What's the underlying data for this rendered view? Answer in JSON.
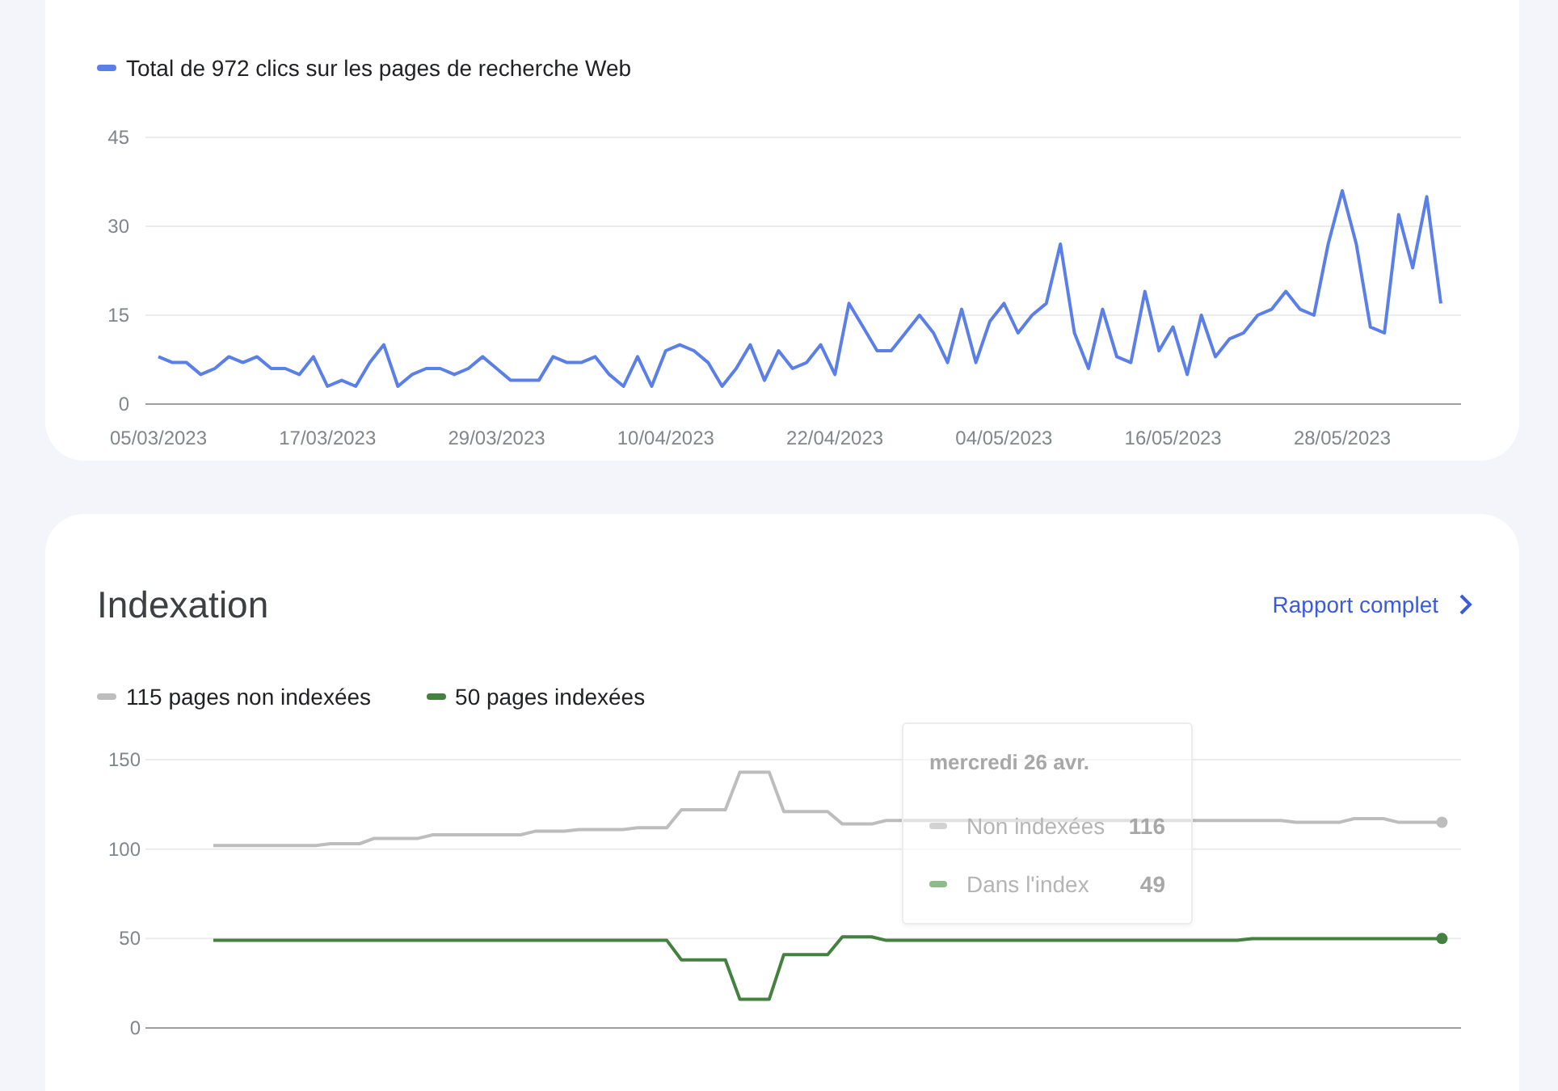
{
  "performance": {
    "chart_data": {
      "type": "line",
      "ylim": [
        0,
        45
      ],
      "yticks": [
        0,
        15,
        30,
        45
      ],
      "categories": [
        "05/03/2023",
        null,
        null,
        null,
        null,
        null,
        null,
        null,
        null,
        null,
        null,
        null,
        "17/03/2023",
        null,
        null,
        null,
        null,
        null,
        null,
        null,
        null,
        null,
        null,
        null,
        "29/03/2023",
        null,
        null,
        null,
        null,
        null,
        null,
        null,
        null,
        null,
        null,
        null,
        "10/04/2023",
        null,
        null,
        null,
        null,
        null,
        null,
        null,
        null,
        null,
        null,
        null,
        "22/04/2023",
        null,
        null,
        null,
        null,
        null,
        null,
        null,
        null,
        null,
        null,
        null,
        "04/05/2023",
        null,
        null,
        null,
        null,
        null,
        null,
        null,
        null,
        null,
        null,
        null,
        "16/05/2023",
        null,
        null,
        null,
        null,
        null,
        null,
        null,
        null,
        null,
        null,
        null,
        "28/05/2023",
        null,
        null,
        null,
        null,
        null,
        null,
        null
      ],
      "series": [
        {
          "name": "Total de 972 clics sur les pages de recherche Web",
          "color": "#5b7fe8",
          "values": [
            8,
            7,
            7,
            5,
            6,
            8,
            7,
            8,
            6,
            6,
            5,
            8,
            3,
            4,
            3,
            7,
            10,
            3,
            5,
            6,
            6,
            5,
            6,
            8,
            6,
            4,
            4,
            4,
            8,
            7,
            7,
            8,
            5,
            3,
            8,
            3,
            9,
            10,
            9,
            7,
            3,
            6,
            10,
            4,
            9,
            6,
            7,
            10,
            5,
            17,
            13,
            9,
            9,
            12,
            15,
            12,
            7,
            16,
            7,
            14,
            17,
            12,
            15,
            17,
            27,
            12,
            6,
            16,
            8,
            7,
            19,
            9,
            13,
            5,
            15,
            8,
            11,
            12,
            15,
            16,
            19,
            16,
            15,
            27,
            36,
            27,
            13,
            12,
            32,
            23,
            35,
            17
          ]
        }
      ]
    }
  },
  "indexation": {
    "title": "Indexation",
    "link": {
      "label": "Rapport complet"
    },
    "chart_data": {
      "type": "line",
      "ylim": [
        0,
        150
      ],
      "yticks": [
        0,
        50,
        100,
        150
      ],
      "series": [
        {
          "name": "115 pages non indexées",
          "color": "#bdbdbd",
          "values": [
            102,
            102,
            102,
            102,
            102,
            102,
            102,
            102,
            103,
            103,
            103,
            106,
            106,
            106,
            106,
            108,
            108,
            108,
            108,
            108,
            108,
            108,
            110,
            110,
            110,
            111,
            111,
            111,
            111,
            112,
            112,
            112,
            122,
            122,
            122,
            122,
            143,
            143,
            143,
            121,
            121,
            121,
            121,
            114,
            114,
            114,
            116,
            116,
            116,
            116,
            116,
            116,
            116,
            116,
            116,
            116,
            116,
            116,
            116,
            116,
            116,
            116,
            116,
            116,
            116,
            116,
            116,
            116,
            116,
            116,
            116,
            116,
            116,
            116,
            115,
            115,
            115,
            115,
            117,
            117,
            117,
            115,
            115,
            115,
            115
          ]
        },
        {
          "name": "50 pages indexées",
          "color": "#44803f",
          "values": [
            49,
            49,
            49,
            49,
            49,
            49,
            49,
            49,
            49,
            49,
            49,
            49,
            49,
            49,
            49,
            49,
            49,
            49,
            49,
            49,
            49,
            49,
            49,
            49,
            49,
            49,
            49,
            49,
            49,
            49,
            49,
            49,
            38,
            38,
            38,
            38,
            16,
            16,
            16,
            41,
            41,
            41,
            41,
            51,
            51,
            51,
            49,
            49,
            49,
            49,
            49,
            49,
            49,
            49,
            49,
            49,
            49,
            49,
            49,
            49,
            49,
            49,
            49,
            49,
            49,
            49,
            49,
            49,
            49,
            49,
            49,
            50,
            50,
            50,
            50,
            50,
            50,
            50,
            50,
            50,
            50,
            50,
            50,
            50,
            50
          ]
        }
      ]
    },
    "tooltip": {
      "date": "mercredi 26 avr.",
      "rows": [
        {
          "label": "Non indexées",
          "value": "116",
          "color": "#d2d2d2"
        },
        {
          "label": "Dans l'index",
          "value": "49",
          "color": "#8fbb8b"
        }
      ]
    }
  }
}
